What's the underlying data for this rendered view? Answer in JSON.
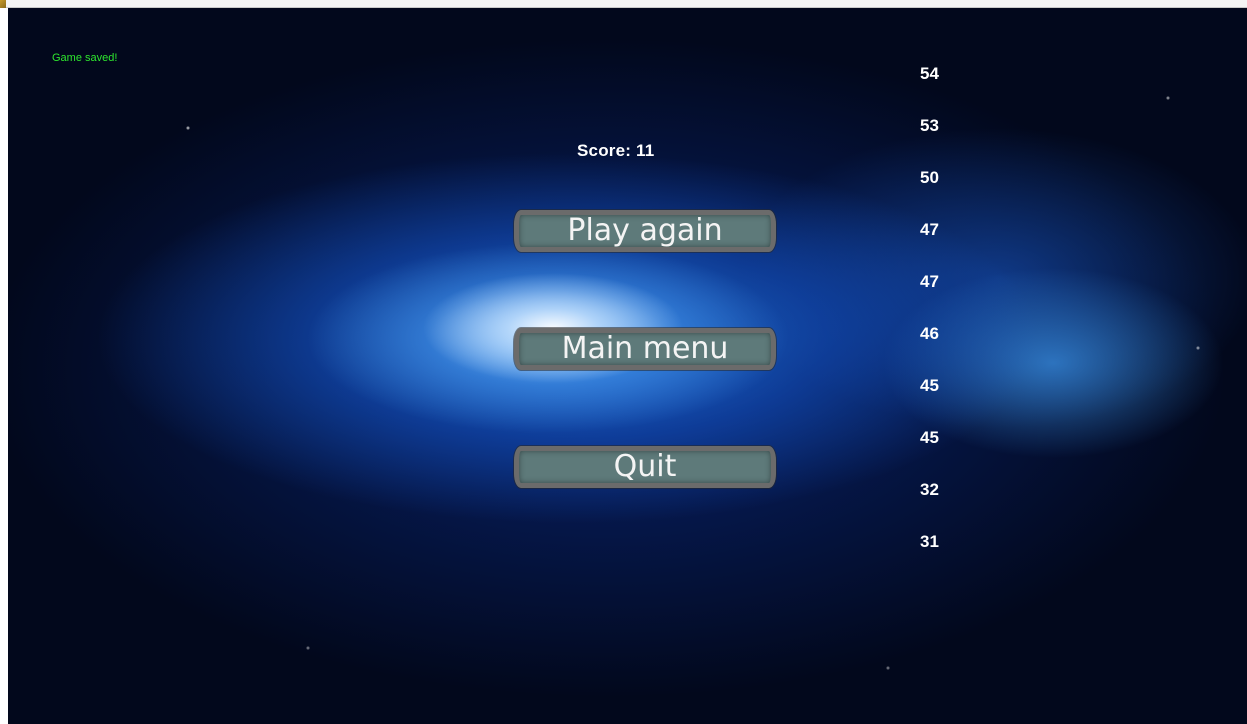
{
  "status_message": "Game saved!",
  "score_text": "Score: 11",
  "menu": {
    "play_again": "Play again",
    "main_menu": "Main menu",
    "quit": "Quit"
  },
  "high_scores": [
    "54",
    "53",
    "50",
    "47",
    "47",
    "46",
    "45",
    "45",
    "32",
    "31"
  ],
  "colors": {
    "status_text": "#2ee62e",
    "button_fill": "#5e7a7a",
    "button_border": "#6b6b6b",
    "background": "#02081c"
  }
}
